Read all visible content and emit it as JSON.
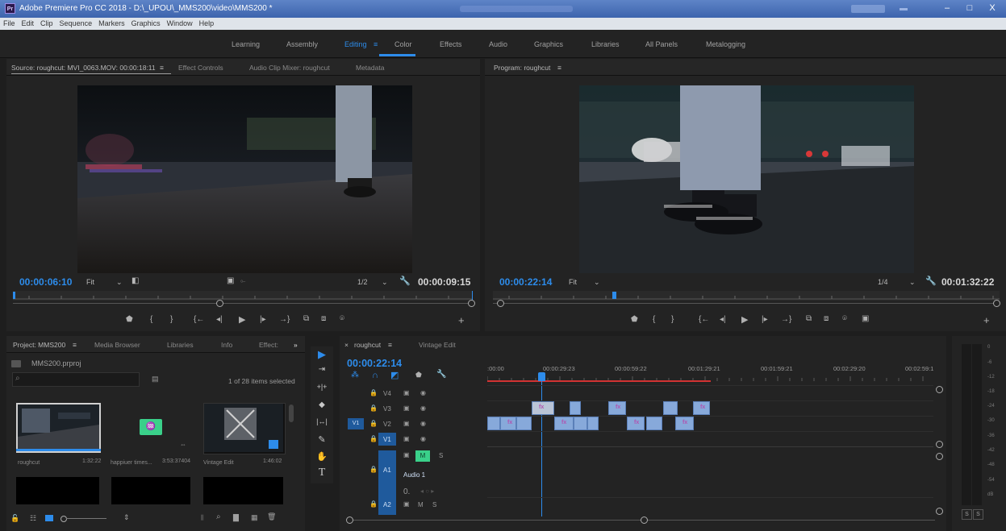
{
  "app": {
    "title": "Adobe Premiere Pro CC 2018 - D:\\_UPOU\\_MMS200\\video\\MMS200 *",
    "logo_text": "Pr"
  },
  "window_controls": {
    "minimize": "–",
    "maximize": "□",
    "close": "X"
  },
  "menu": [
    "File",
    "Edit",
    "Clip",
    "Sequence",
    "Markers",
    "Graphics",
    "Window",
    "Help"
  ],
  "workspaces": [
    "Learning",
    "Assembly",
    "Editing",
    "Color",
    "Effects",
    "Audio",
    "Graphics",
    "Libraries",
    "All Panels",
    "Metalogging"
  ],
  "workspace_active": "Editing",
  "workspace_menu_glyph": "≡",
  "source": {
    "tabs": [
      "Source: roughcut: MVI_0063.MOV: 00:00:18:11",
      "Effect Controls",
      "Audio Clip Mixer: roughcut",
      "Metadata"
    ],
    "menu_glyph": "≡",
    "timecode": "00:00:06:10",
    "zoom": "Fit",
    "resolution": "1/2",
    "duration": "00:00:09:15"
  },
  "program": {
    "tab": "Program: roughcut",
    "menu_glyph": "≡",
    "timecode": "00:00:22:14",
    "zoom": "Fit",
    "resolution": "1/4",
    "duration": "00:01:32:22"
  },
  "project": {
    "tabs": [
      "Project: MMS200",
      "Media Browser",
      "Libraries",
      "Info",
      "Effect:"
    ],
    "menu_glyph": "≡",
    "overflow": "»",
    "file": "MMS200.prproj",
    "selection": "1 of 28 items selected",
    "items": [
      {
        "name": "roughcut",
        "duration": "1:32:22"
      },
      {
        "name": "happiuer times...",
        "duration": "3:53:37404"
      },
      {
        "name": "Vintage Edit",
        "duration": "1:46:02"
      }
    ]
  },
  "timeline": {
    "tabs": [
      "roughcut",
      "Vintage Edit"
    ],
    "close_glyph": "×",
    "menu_glyph": "≡",
    "timecode": "00:00:22:14",
    "ruler": [
      ":00:00",
      "00:00:29:23",
      "00:00:59:22",
      "00:01:29:21",
      "00:01:59:21",
      "00:02:29:20",
      "00:02:59:1"
    ],
    "tracks": {
      "v4": "V4",
      "v3": "V3",
      "v2": "V2",
      "v1": "V1",
      "a1": "A1",
      "a2": "A2",
      "v1_src": "V1"
    },
    "audio1_label": "Audio 1",
    "audio_level": "0.",
    "m_label": "M",
    "s_label": "S",
    "fx_label": "fx"
  },
  "meter": {
    "scale": [
      "0",
      "-6",
      "-12",
      "-18",
      "-24",
      "-30",
      "-36",
      "-42",
      "-48",
      "-54",
      "dB"
    ],
    "solo": [
      "S",
      "S"
    ]
  },
  "icons": {
    "marker": "⬟",
    "in": "{",
    "out": "}",
    "goto_in": "{←",
    "step_back": "◂|",
    "play": "▶",
    "step_fwd": "|▸",
    "goto_out": "→}",
    "insert": "⧉",
    "overwrite": "⧈",
    "camera": "⌾",
    "compare": "▣",
    "add": "+",
    "wrench": "🔧",
    "selection": "▶",
    "track_select": "⇥",
    "ripple": "+|+",
    "razor": "◆",
    "slip": "|↔|",
    "pen": "✎",
    "hand": "✋",
    "type": "T",
    "lock": "🔒",
    "eye": "◉",
    "film": "▣",
    "search": "⌕",
    "new_bin": "▇",
    "new_item": "▦",
    "trash": "🗑"
  },
  "colors": {
    "accent": "#2d8ceb",
    "clip": "#87a9da",
    "fx": "#b054b0",
    "playhead_red": "#d23232",
    "audio_green": "#3ad08a"
  }
}
